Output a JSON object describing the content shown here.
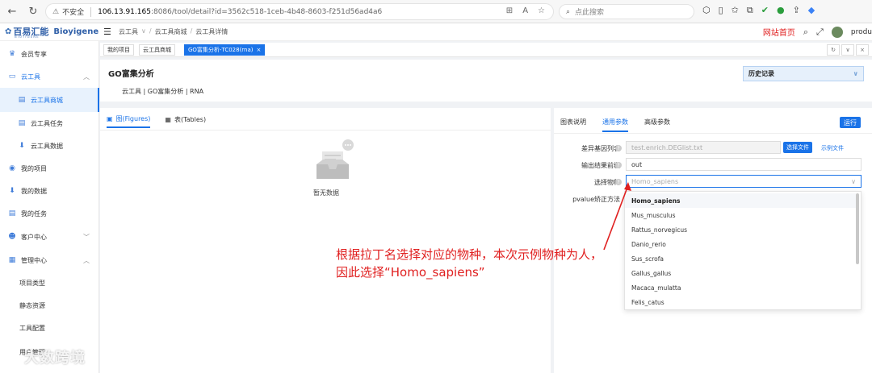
{
  "browser": {
    "insecure_label": "不安全",
    "url_host": "106.13.91.165",
    "url_rest": ":8086/tool/detail?id=3562c518-1ceb-4b48-8603-f251d56ad4a6",
    "search_placeholder": "点此搜索"
  },
  "header": {
    "logo_cn": "百易汇能",
    "logo_en": "Bioyigene",
    "logo_sub": "BIOYIGENE",
    "breadcrumbs": [
      "云工具",
      "云工具商城",
      "云工具详情"
    ],
    "site_link": "网站首页",
    "user": "produ"
  },
  "sidebar": {
    "items": [
      {
        "label": "会员专享",
        "icon": "vip-icon"
      },
      {
        "label": "云工具",
        "icon": "cloud-icon"
      },
      {
        "label": "云工具商城",
        "icon": "store-icon"
      },
      {
        "label": "云工具任务",
        "icon": "task-icon"
      },
      {
        "label": "云工具数据",
        "icon": "data-icon"
      },
      {
        "label": "我的项目",
        "icon": "project-icon"
      },
      {
        "label": "我的数据",
        "icon": "data-icon"
      },
      {
        "label": "我的任务",
        "icon": "task-icon"
      },
      {
        "label": "客户中心",
        "icon": "customer-icon"
      },
      {
        "label": "管理中心",
        "icon": "admin-icon"
      },
      {
        "label": "项目类型"
      },
      {
        "label": "静态资源"
      },
      {
        "label": "工具配置"
      },
      {
        "label": "用户管理"
      }
    ]
  },
  "tabs": [
    {
      "label": "我的项目"
    },
    {
      "label": "云工具商城"
    },
    {
      "label": "GO富集分析-TC028(rna)"
    }
  ],
  "page": {
    "title": "GO富集分析",
    "subtitle": "云工具 | GO富集分析 | RNA",
    "history_label": "历史记录"
  },
  "results": {
    "tab_figures": "图(Figures)",
    "tab_tables": "表(Tables)",
    "empty_text": "暂无数据"
  },
  "params": {
    "tabs": [
      "图表说明",
      "通用参数",
      "高级参数"
    ],
    "run_label": "运行",
    "rows": [
      {
        "label": "差异基因列表",
        "value": "test.enrich.DEGlist.txt"
      },
      {
        "label": "输出结果前缀",
        "value": "out"
      },
      {
        "label": "选择物种",
        "value": "Homo_sapiens"
      },
      {
        "label": "pvalue矫正方法",
        "value": ""
      }
    ],
    "choose_file_label": "选择文件",
    "example_file_label": "示例文件"
  },
  "species_options": [
    "Homo_sapiens",
    "Mus_musculus",
    "Rattus_norvegicus",
    "Danio_rerio",
    "Sus_scrofa",
    "Gallus_gallus",
    "Macaca_mulatta",
    "Felis_catus"
  ],
  "annotation": {
    "line1": "根据拉丁名选择对应的物种，本次示例物种为人，",
    "line2": "因此选择“Homo_sapiens”",
    "color": "#e02020"
  },
  "watermark": "大数跨境",
  "colors": {
    "accent": "#1a73e8",
    "site_link": "#e02020"
  }
}
